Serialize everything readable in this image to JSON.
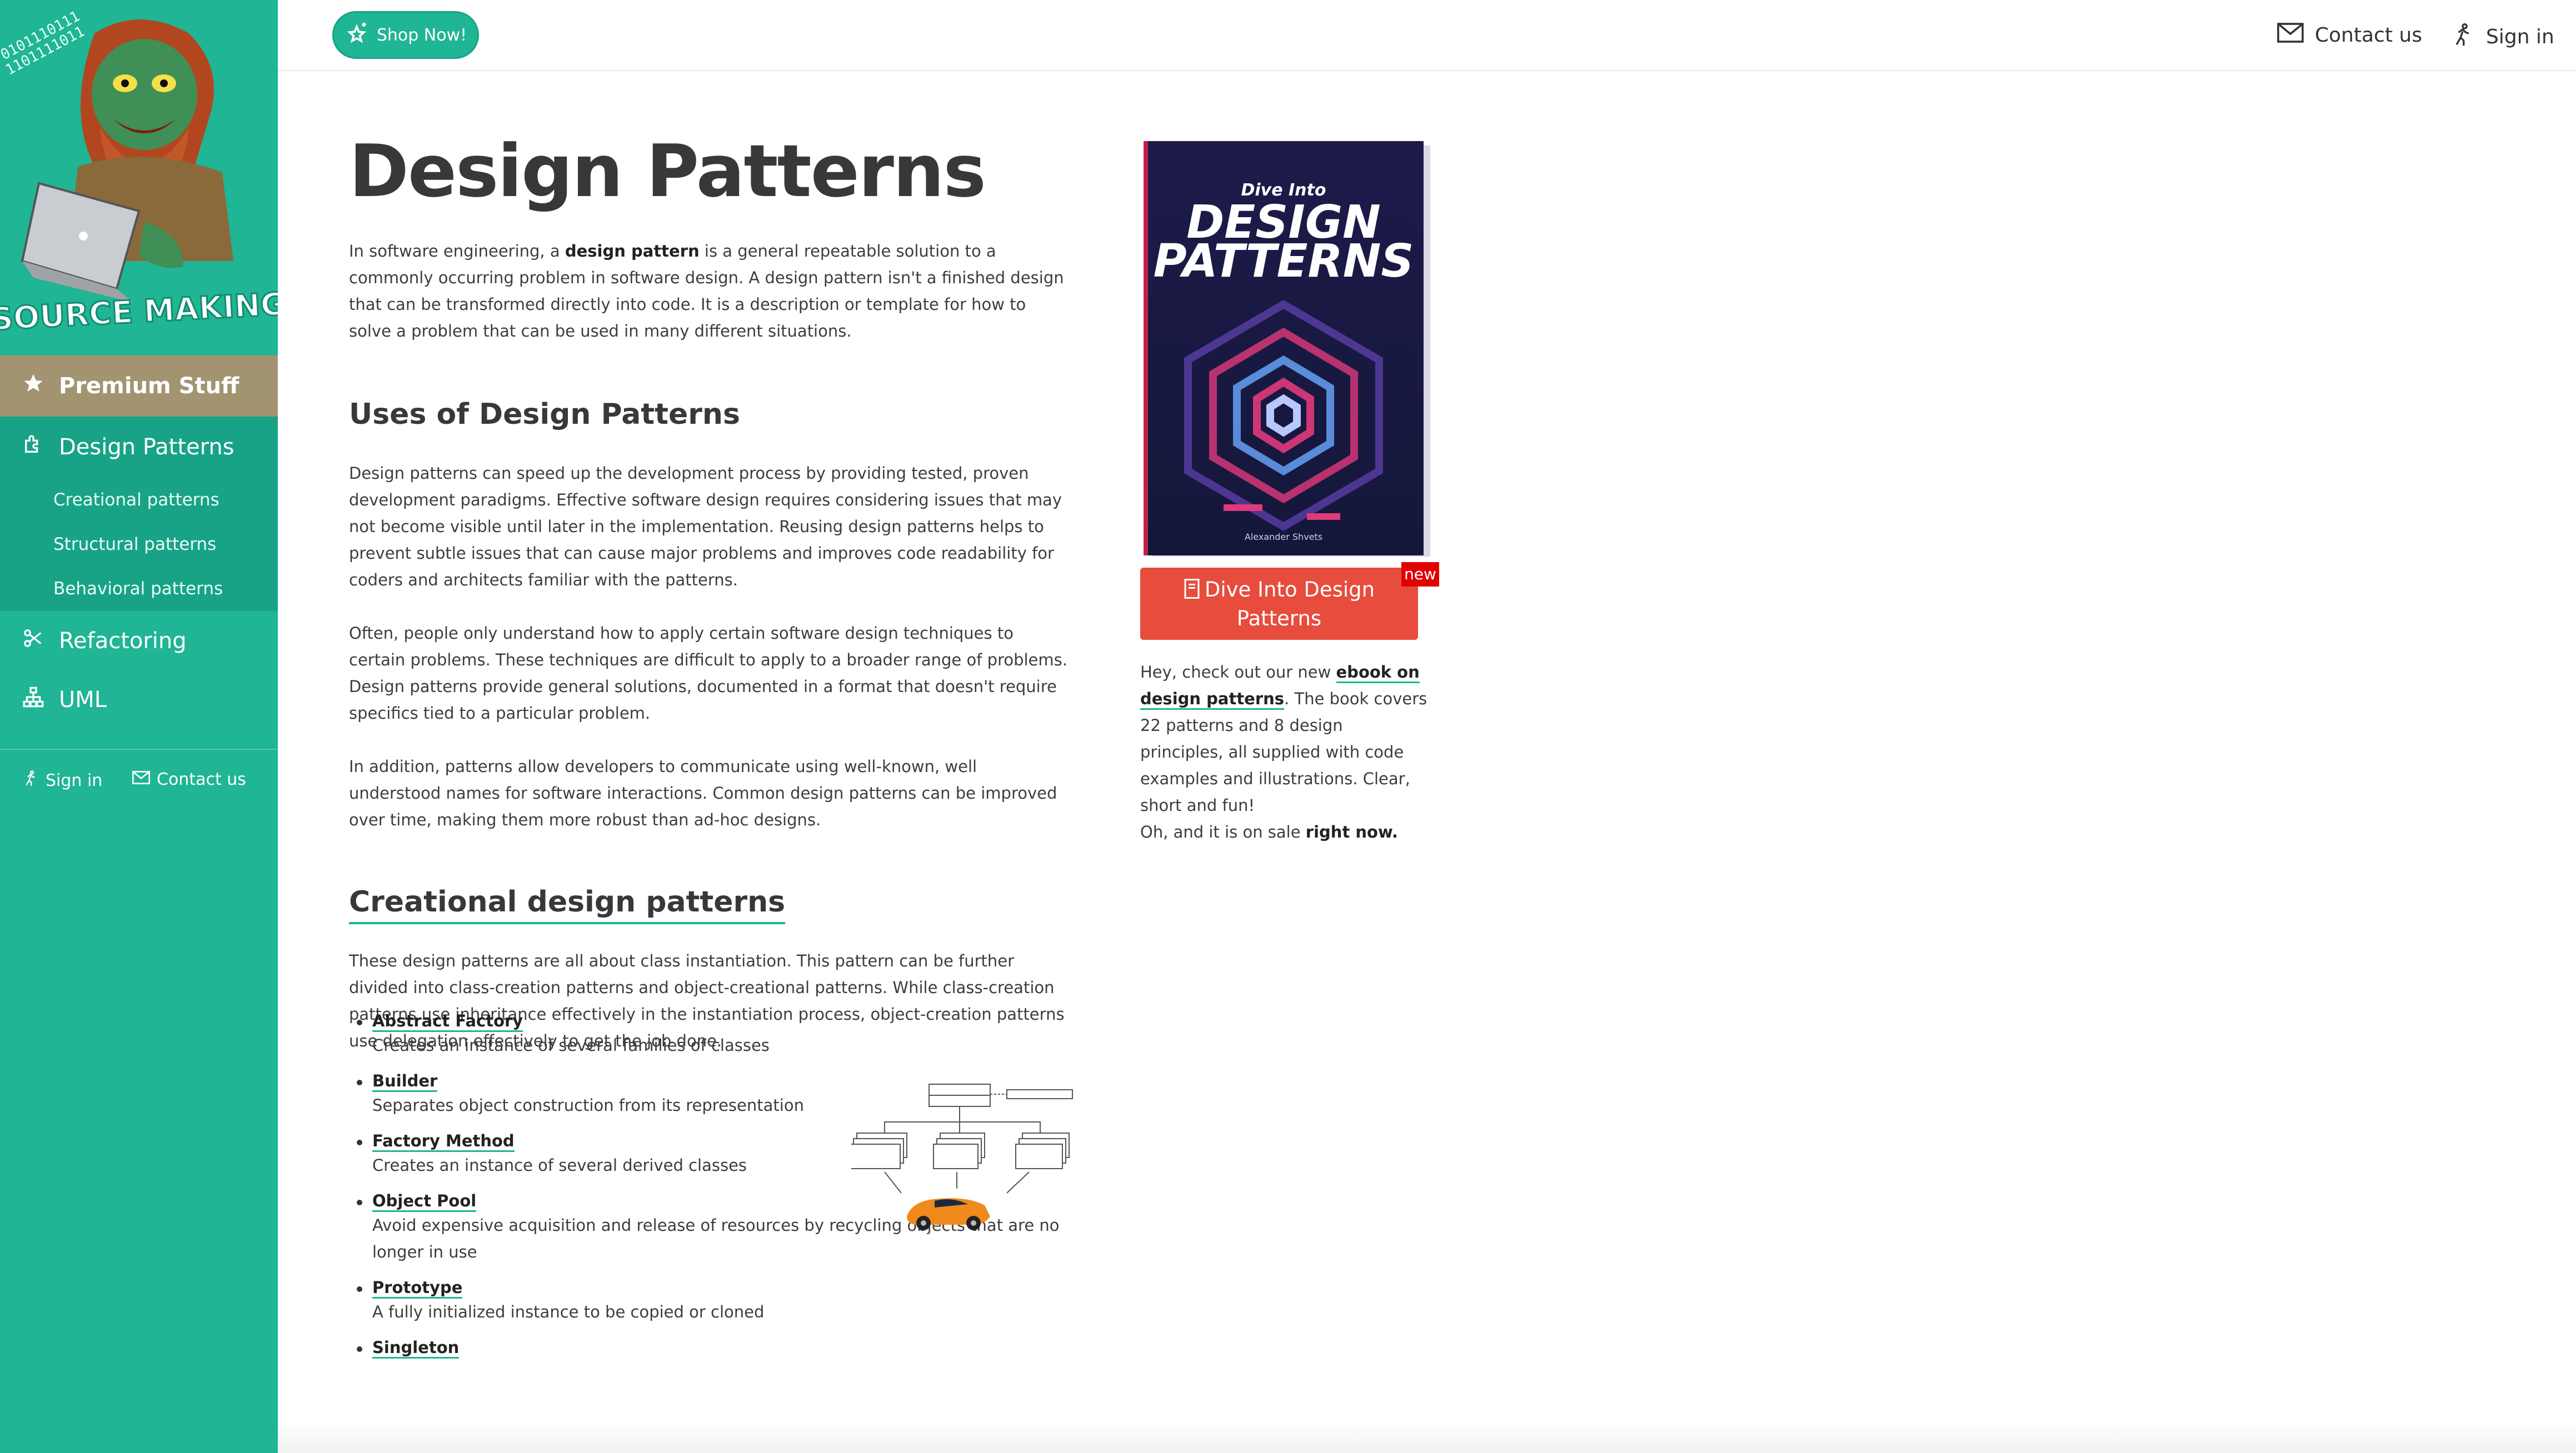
{
  "brand": {
    "logo_text": "SOURCE MAKING",
    "accent": "#1fb595",
    "premium_color": "#a29471"
  },
  "sidebar": {
    "premium": {
      "label": "Premium Stuff",
      "icon": "star-icon"
    },
    "design_patterns": {
      "label": "Design Patterns",
      "icon": "puzzle-icon"
    },
    "sub_items": [
      {
        "label": "Creational patterns"
      },
      {
        "label": "Structural patterns"
      },
      {
        "label": "Behavioral patterns"
      }
    ],
    "refactoring": {
      "label": "Refactoring",
      "icon": "scissors-icon"
    },
    "uml": {
      "label": "UML",
      "icon": "sitemap-icon"
    },
    "sign_in": "Sign in",
    "contact_us": "Contact us"
  },
  "topbar": {
    "shop_label": "Shop Now!",
    "contact_label": "Contact us",
    "signin_label": "Sign in"
  },
  "main": {
    "title": "Design Patterns",
    "intro": {
      "pre": "In software engineering, a ",
      "bold": "design pattern",
      "post": " is a general repeatable solution to a commonly occurring problem in software design. A design pattern isn't a finished design that can be transformed directly into code. It is a description or template for how to solve a problem that can be used in many different situations."
    },
    "uses_heading": "Uses of Design Patterns",
    "uses_p1": "Design patterns can speed up the development process by providing tested, proven development paradigms. Effective software design requires considering issues that may not become visible until later in the implementation. Reusing design patterns helps to prevent subtle issues that can cause major problems and improves code readability for coders and architects familiar with the patterns.",
    "uses_p2": "Often, people only understand how to apply certain software design techniques to certain problems. These techniques are difficult to apply to a broader range of problems. Design patterns provide general solutions, documented in a format that doesn't require specifics tied to a particular problem.",
    "uses_p3": "In addition, patterns allow developers to communicate using well-known, well understood names for software interactions. Common design patterns can be improved over time, making them more robust than ad-hoc designs.",
    "creational_heading": "Creational design patterns",
    "creational_p": "These design patterns are all about class instantiation. This pattern can be further divided into class-creation patterns and object-creational patterns. While class-creation patterns use inheritance effectively in the instantiation process, object-creation patterns use delegation effectively to get the job done.",
    "patterns": [
      {
        "name": "Abstract Factory",
        "desc": "Creates an instance of several families of classes"
      },
      {
        "name": "Builder",
        "desc": "Separates object construction from its representation"
      },
      {
        "name": "Factory Method",
        "desc": "Creates an instance of several derived classes"
      },
      {
        "name": "Object Pool",
        "desc": "Avoid expensive acquisition and release of resources by recycling objects that are no longer in use"
      },
      {
        "name": "Prototype",
        "desc": "A fully initialized instance to be copied or cloned"
      },
      {
        "name": "Singleton",
        "desc": ""
      }
    ]
  },
  "aside": {
    "book": {
      "top": "Dive Into",
      "title_line1": "DESIGN",
      "title_line2": "PATTERNS",
      "author": "Alexander Shvets"
    },
    "buy_label": "Dive Into Design Patterns",
    "badge": "new",
    "promo_pre": "Hey, check out our new ",
    "promo_link": "ebook on design patterns",
    "promo_post": ". The book covers 22 patterns and 8 design principles, all supplied with code examples and illustrations. Clear, short and fun!",
    "sale_pre": "Oh, and it is on sale ",
    "sale_bold": "right now."
  }
}
